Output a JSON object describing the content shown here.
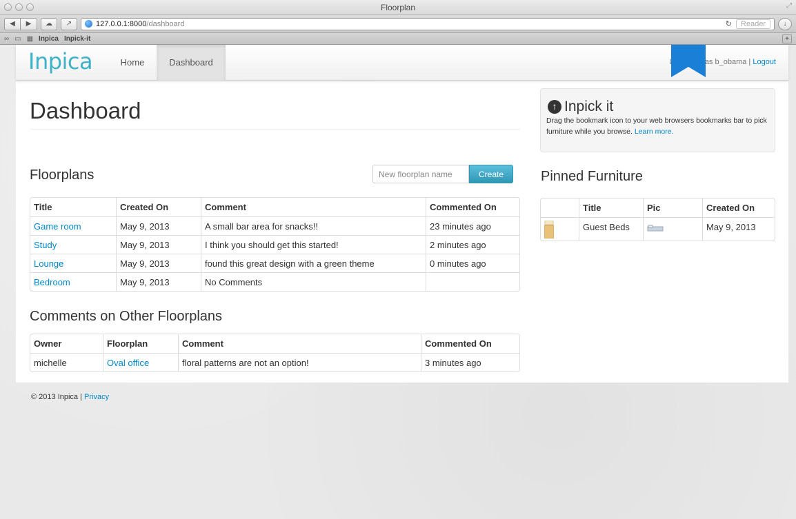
{
  "window": {
    "title": "Floorplan"
  },
  "browser": {
    "url_host": "127.0.0.1:8000",
    "url_path": "/dashboard",
    "reader_label": "Reader",
    "bookmarks": [
      "Inpica",
      "Inpick-it"
    ]
  },
  "nav": {
    "brand": "Inpica",
    "home": "Home",
    "dashboard": "Dashboard",
    "logged_in_text": "Logged in as b_obama | ",
    "logout": "Logout"
  },
  "page_title": "Dashboard",
  "floorplans": {
    "heading": "Floorplans",
    "new_placeholder": "New floorplan name",
    "create_label": "Create",
    "columns": [
      "Title",
      "Created On",
      "Comment",
      "Commented On"
    ],
    "rows": [
      {
        "title": "Game room",
        "created": "May 9, 2013",
        "comment": "A small bar area for snacks!!",
        "commented": "23 minutes ago"
      },
      {
        "title": "Study",
        "created": "May 9, 2013",
        "comment": "I think you should get this started!",
        "commented": "2 minutes ago"
      },
      {
        "title": "Lounge",
        "created": "May 9, 2013",
        "comment": "found this great design with a green theme",
        "commented": "0 minutes ago"
      },
      {
        "title": "Bedroom",
        "created": "May 9, 2013",
        "comment": "No Comments",
        "commented": ""
      }
    ]
  },
  "comments": {
    "heading": "Comments on Other Floorplans",
    "columns": [
      "Owner",
      "Floorplan",
      "Comment",
      "Commented On"
    ],
    "rows": [
      {
        "owner": "michelle",
        "floorplan": "Oval office",
        "comment": "floral patterns are not an option!",
        "commented": "3 minutes ago"
      }
    ]
  },
  "inpick": {
    "title": "Inpick it",
    "text": "Drag the bookmark icon to your web browsers bookmarks bar to pick furniture while you browse. ",
    "learn_more": "Learn more."
  },
  "pinned": {
    "heading": "Pinned Furniture",
    "columns": [
      "",
      "Title",
      "Pic",
      "Created On"
    ],
    "rows": [
      {
        "title": "Guest Beds",
        "created": "May 9, 2013"
      }
    ]
  },
  "footer": {
    "copyright": "© 2013 Inpica | ",
    "privacy": "Privacy"
  },
  "colors": {
    "brand": "#3fb1c9",
    "link": "#0088cc",
    "ribbon": "#1a7fd6",
    "create_button": "#2f96b4"
  }
}
